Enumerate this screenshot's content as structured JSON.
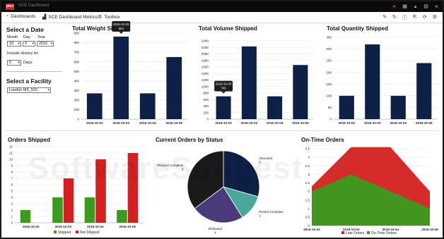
{
  "app": {
    "logo_text": "plex",
    "title": "SCE Dashboard",
    "titlebar_icons": [
      "user-icon",
      "mail-icon",
      "bell-icon",
      "grid-icon",
      "close-icon"
    ]
  },
  "menu": {
    "items": [
      {
        "icon": "dashboards-icon",
        "label": "Dashboards"
      },
      {
        "icon": "metrics-icon",
        "label": "SCE Dashboard Metrics"
      },
      {
        "icon": "toolbox-icon",
        "label": "Toolbox"
      }
    ],
    "tools": [
      "edit-icon",
      "refresh-icon",
      "info-icon",
      "export-icon",
      "share-icon",
      "settings-icon"
    ]
  },
  "date_panel": {
    "title": "Select a Date",
    "month_label": "Month",
    "day_label": "Day",
    "year_label": "Year",
    "month_value": "10",
    "day_value": "5",
    "year_value": "2016",
    "history_label": "Include History for",
    "history_value": "5",
    "days_label": "Days"
  },
  "facility_panel": {
    "title": "Select a Facility",
    "value": "London M3_910"
  },
  "watermark": "SoftwareSuggest",
  "colors": {
    "navy": "#0d2147",
    "green": "#3a9b1f",
    "red": "#d42020",
    "slice_shipped": "#1a1a1a",
    "slice_allocated": "#0d2147",
    "slice_picked": "#4aa89a",
    "slice_released": "#4b3a7a"
  },
  "chart_data": [
    {
      "id": "weight",
      "type": "bar",
      "title": "Total Weight Shipped",
      "categories": [
        "2016-10-02",
        "2016-10-03",
        "2016-10-04",
        "2016-10-05"
      ],
      "values": [
        270,
        864,
        270,
        650
      ],
      "ylim": [
        0,
        900
      ],
      "yticks": [
        0,
        100,
        200,
        300,
        400,
        500,
        600,
        700,
        800,
        900
      ],
      "tooltip": {
        "index": 1,
        "date": "2016-10-03",
        "value": "864"
      }
    },
    {
      "id": "volume",
      "type": "bar",
      "title": "Total Volume Shipped",
      "categories": [
        "2016-10-02",
        "2016-10-03",
        "2016-10-04",
        "2016-10-05"
      ],
      "values": [
        700,
        2230,
        700,
        1660
      ],
      "ylim": [
        0,
        2400
      ],
      "yticks": [
        0,
        200,
        400,
        600,
        800,
        1000,
        1200,
        1400,
        1600,
        1800,
        2000,
        2200,
        2400
      ],
      "tooltip": {
        "index": 0,
        "date": "2016-10-03",
        "value": "700"
      }
    },
    {
      "id": "quantity",
      "type": "bar",
      "title": "Total Quantity Shipped",
      "categories": [
        "2016-10-02",
        "2016-10-03",
        "2016-10-04",
        "2016-10-05"
      ],
      "values": [
        100,
        320,
        100,
        240
      ],
      "ylim": [
        0,
        350
      ],
      "yticks": [
        0,
        50,
        100,
        150,
        200,
        250,
        300,
        350
      ]
    },
    {
      "id": "orders",
      "type": "bar",
      "title": "Orders Shipped",
      "categories": [
        "2016-10-02",
        "2016-10-03",
        "2016-10-04",
        "2016-10-05"
      ],
      "series": [
        {
          "name": "Shipped",
          "values": [
            2,
            4,
            4,
            2
          ]
        },
        {
          "name": "Not Shipped",
          "values": [
            0,
            7,
            10,
            11
          ]
        }
      ],
      "ylim": [
        0,
        12
      ],
      "yticks": [
        0,
        1,
        2,
        3,
        4,
        5,
        6,
        7,
        8,
        9,
        10,
        11,
        12
      ],
      "legend": "bottom"
    },
    {
      "id": "status",
      "type": "pie",
      "title": "Current Orders by Status",
      "slices": [
        {
          "name": "Allocated",
          "value": 5
        },
        {
          "name": "Picked Complete",
          "value": 2
        },
        {
          "name": "Released",
          "value": 4
        },
        {
          "name": "Shipped Complete",
          "value": 6
        }
      ]
    },
    {
      "id": "ontime",
      "type": "area",
      "title": "On-Time Orders",
      "categories": [
        "2016-10-02",
        "2016-10-03",
        "2016-10-04",
        "2016-10-05"
      ],
      "series": [
        {
          "name": "Late Orders",
          "values": [
            2.3,
            4.6,
            4.6,
            2.0
          ]
        },
        {
          "name": "On-Time Orders",
          "values": [
            2.0,
            3.0,
            2.0,
            1.0
          ]
        }
      ],
      "ylim": [
        0,
        4.5
      ],
      "yticks": [
        0,
        0.5,
        1,
        1.5,
        2,
        2.5,
        3,
        3.5,
        4,
        4.5
      ],
      "legend": "bottom"
    }
  ]
}
